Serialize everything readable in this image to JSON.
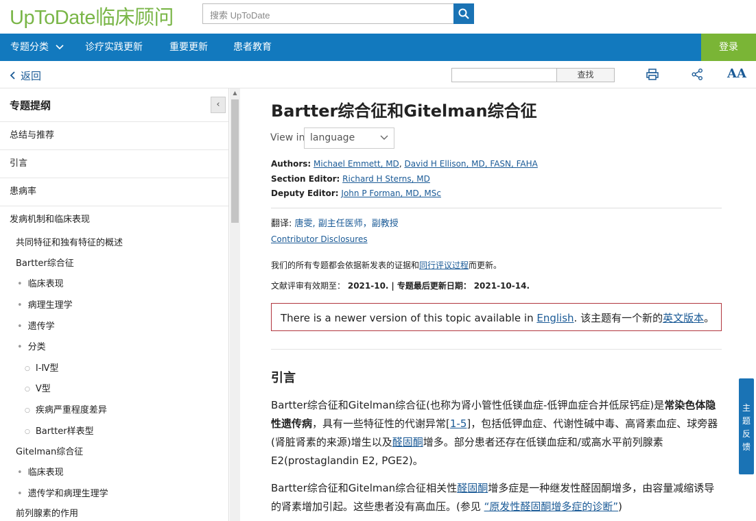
{
  "header": {
    "logo": "UpToDate临床顾问",
    "search_placeholder": "搜索 UpToDate"
  },
  "nav": {
    "items": [
      "专题分类",
      "诊疗实践更新",
      "重要更新",
      "患者教育"
    ],
    "login": "登录"
  },
  "toolbar": {
    "back": "返回",
    "find_label": "查找",
    "font_label": "AA"
  },
  "sidebar": {
    "title": "专题提纲",
    "sections": [
      "总结与推荐",
      "引言",
      "患病率",
      "发病机制和临床表现"
    ],
    "items": [
      "共同特征和独有特征的概述",
      "Bartter综合征",
      "临床表现",
      "病理生理学",
      "遗传学",
      "分类",
      "Ⅰ-Ⅳ型",
      "Ⅴ型",
      "疾病严重程度差异",
      "Bartter样表型",
      "Gitelman综合征",
      "临床表现",
      "遗传学和病理生理学",
      "前列腺素的作用"
    ]
  },
  "article": {
    "title": "Bartter综合征和Gitelman综合征",
    "view_in_label": "View in",
    "language_value": "language",
    "authors_label": "Authors:",
    "authors": [
      "Michael Emmett, MD",
      "David H Ellison, MD, FASN, FAHA"
    ],
    "section_editor_label": "Section Editor:",
    "section_editor": "Richard H Sterns, MD",
    "deputy_editor_label": "Deputy Editor:",
    "deputy_editor": "John P Forman, MD, MSc",
    "translator_label": "翻译:",
    "translator": "唐雯, 副主任医师，副教授",
    "disclosures": "Contributor Disclosures",
    "update_note_pre": "我们的所有专题都会依据新发表的证据和",
    "update_note_link": "同行评议过程",
    "update_note_post": "而更新。",
    "review_label": "文献评审有效期至：",
    "review_date": "2021-10.",
    "updated_label": "| 专题最后更新日期：",
    "updated_date": "2021-10-14.",
    "banner_text": "There is a newer version of this topic available in",
    "banner_link": "English",
    "banner_cn": ". 该主题有一个新的",
    "banner_cn_link": "英文版本",
    "banner_end": "。",
    "intro_heading": "引言",
    "p1_a": "Bartter综合征和Gitelman综合征(也称为肾小管性低镁血症-低钾血症合并低尿钙症)是",
    "p1_b": "常染色体隐性遗传病",
    "p1_c": "，具有一些特征性的代谢异常[",
    "p1_ref": "1-5",
    "p1_d": "]，包括低钾血症、代谢性碱中毒、高肾素血症、球旁器(肾脏肾素的来源)增生以及",
    "p1_link": "醛固酮",
    "p1_e": "增多。部分患者还存在低镁血症和/或高水平前列腺素E2(prostaglandin E2, PGE2)。",
    "p2_a": "Bartter综合征和Gitelman综合征相关性",
    "p2_link": "醛固酮",
    "p2_b": "增多症是一种继发性醛固酮增多，由容量减缩诱导的肾素增加引起。这些患者没有高血压。(参见 ",
    "p2_link2": "“原发性醛固酮增多症的诊断”",
    "p2_c": ")"
  },
  "feedback": "主题反馈"
}
